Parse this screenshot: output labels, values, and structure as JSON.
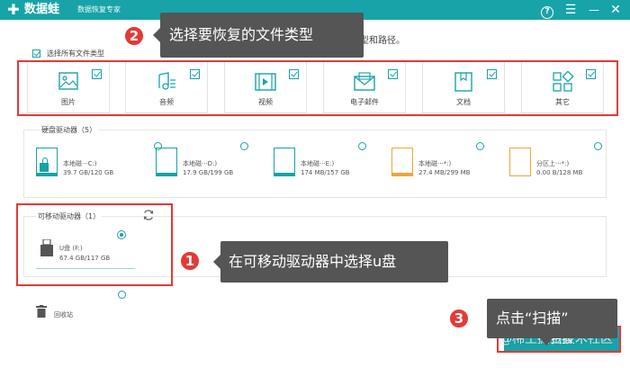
{
  "app": {
    "name": "数据蛙",
    "subtitle": "数据恢复专家",
    "logo_glyph": "✚",
    "accent_color": "#17a3a8",
    "help_label": "?",
    "menu_icon": "menu-icon",
    "min_label": "—",
    "close_label": "✕"
  },
  "instruction_tail": "类型和路径。",
  "select_all": {
    "label": "选择所有文件类型",
    "checked": true
  },
  "file_types": [
    {
      "label": "图片",
      "icon": "image-icon",
      "checked": true
    },
    {
      "label": "音频",
      "icon": "audio-icon",
      "checked": true
    },
    {
      "label": "视频",
      "icon": "video-icon",
      "checked": true
    },
    {
      "label": "电子邮件",
      "icon": "email-icon",
      "checked": true
    },
    {
      "label": "文档",
      "icon": "document-icon",
      "checked": true
    },
    {
      "label": "其它",
      "icon": "other-icon",
      "checked": true
    }
  ],
  "hard_disk": {
    "title": "硬盘驱动器（5）",
    "drives": [
      {
        "name": "本地磁···C:)",
        "size": "39.7 GB/120 GB",
        "system": true,
        "color": "teal"
      },
      {
        "name": "本地磁···D:)",
        "size": "17.9 GB/199 GB",
        "system": false,
        "color": "teal"
      },
      {
        "name": "本地磁···E:)",
        "size": "174 MB/157 GB",
        "system": false,
        "color": "teal"
      },
      {
        "name": "本地磁···*:)",
        "size": "27.4 MB/299 MB",
        "system": false,
        "color": "orange"
      },
      {
        "name": "分区上···*:)",
        "size": "0.00  B/128 MB",
        "system": false,
        "color": "orange"
      }
    ]
  },
  "removable": {
    "title": "可移动驱动器（1）",
    "refresh_icon": "refresh-icon",
    "drive": {
      "name": "U盘 (F:)",
      "size": "67.4 GB/117 GB",
      "selected": true
    }
  },
  "recycle_bin": {
    "label": "回收站",
    "icon": "trash-icon"
  },
  "callouts": [
    {
      "number": "2",
      "text": "选择要恢复的文件类型"
    },
    {
      "number": "1",
      "text": "在可移动驱动器中选择u盘"
    },
    {
      "number": "3",
      "text": "点击“扫描”"
    }
  ],
  "scan_button": {
    "label": "扫描"
  },
  "watermark": "@稀土掘金技术社区"
}
